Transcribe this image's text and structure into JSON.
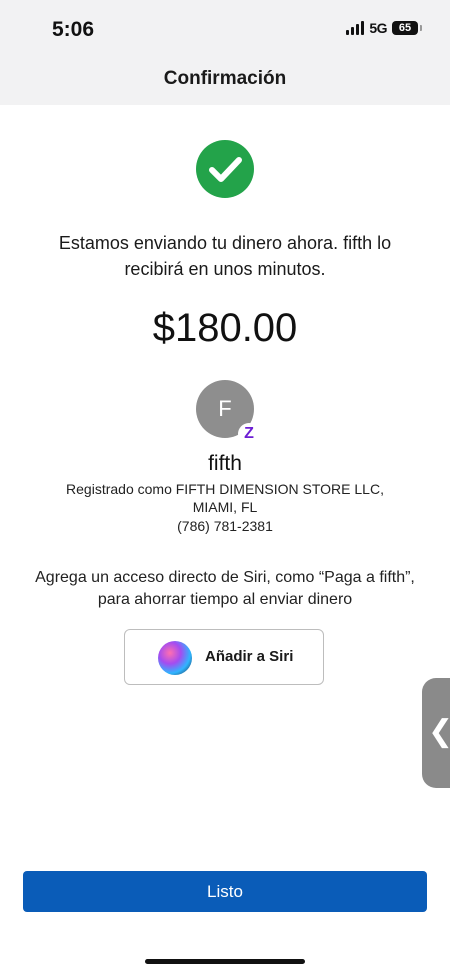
{
  "status_bar": {
    "time": "5:06",
    "network": "5G",
    "battery": "65"
  },
  "nav": {
    "title": "Confirmación"
  },
  "confirmation": {
    "message": "Estamos enviando tu dinero ahora. fifth lo recibirá en unos minutos.",
    "amount": "$180.00",
    "success_color": "#23a34a"
  },
  "recipient": {
    "initial": "F",
    "badge": "Z",
    "name": "fifth",
    "registered_line1": "Registrado como FIFTH DIMENSION STORE LLC,",
    "registered_line2": "MIAMI, FL",
    "phone": "(786) 781-2381"
  },
  "siri": {
    "prompt": "Agrega un acceso directo de Siri, como “Paga a fifth”, para ahorrar tiempo al enviar dinero",
    "button_label": "Añadir a Siri"
  },
  "side_handle": {
    "icon": "chevron-left-icon",
    "glyph": "❮"
  },
  "footer": {
    "done_label": "Listo",
    "button_color": "#0a5cb8"
  }
}
